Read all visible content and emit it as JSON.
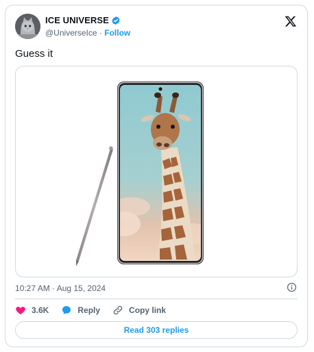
{
  "author": {
    "display_name": "ICE UNIVERSE",
    "handle": "@UniverseIce",
    "separator": "·",
    "follow_label": "Follow",
    "avatar_icon": "cat-avatar-icon",
    "verified_icon": "verified-badge-icon"
  },
  "brand_icon": "x-logo-icon",
  "tweet": {
    "text": "Guess it",
    "timestamp": "10:27 AM · Aug 15, 2024",
    "image_icon": "phone-giraffe-image"
  },
  "actions": {
    "likes": "3.6K",
    "reply_label": "Reply",
    "copy_label": "Copy link"
  },
  "footer": {
    "read_replies_label": "Read 303 replies"
  },
  "colors": {
    "accent": "#1d9bf0",
    "like": "#f91880",
    "text": "#0f1419",
    "muted": "#536471",
    "border": "#cfd9de"
  }
}
